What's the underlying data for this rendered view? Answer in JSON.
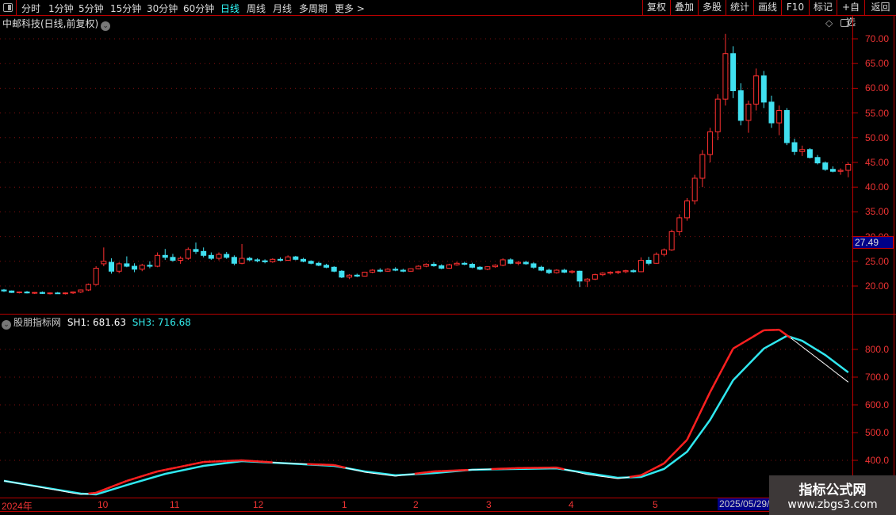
{
  "toolbar": {
    "periods": [
      "分时",
      "1分钟",
      "5分钟",
      "15分钟",
      "30分钟",
      "60分钟",
      "日线",
      "周线",
      "月线",
      "多周期",
      "更多 >"
    ],
    "selected": "日线",
    "buttons": [
      "复权",
      "叠加",
      "多股",
      "统计",
      "画线",
      "F10",
      "标记",
      "+自选",
      "返回"
    ]
  },
  "main": {
    "title": "中邮科技(日线,前复权)",
    "cursor_price": "27.49"
  },
  "indicator": {
    "name": "股朋指标网",
    "sh1_label": "SH1: 681.63",
    "sh3_label": "SH3: 716.68"
  },
  "time_axis": {
    "labels": [
      "2024年",
      "10",
      "11",
      "12",
      "1",
      "2",
      "3",
      "4",
      "5"
    ],
    "cursor_date": "2025/05/29/"
  },
  "watermark": {
    "line1": "指标公式网",
    "line2": "www.zbgs3.com"
  },
  "colors": {
    "up": "#ff3030",
    "down": "#40e0f0",
    "sh1": "#ffffff",
    "sh1_rising": "#ff2020",
    "sh3": "#30e8f0",
    "axis": "#bb0000"
  },
  "chart_data": [
    {
      "type": "candlestick",
      "title": "中邮科技(日线,前复权)",
      "ylim": [
        17,
        72
      ],
      "yticks": [
        "70.00",
        "65.00",
        "60.00",
        "55.00",
        "50.00",
        "45.00",
        "40.00",
        "35.00",
        "30.00",
        "25.00",
        "20.00"
      ],
      "ohlc": [
        [
          19.2,
          19.4,
          18.8,
          19.0
        ],
        [
          19.0,
          19.1,
          18.6,
          18.7
        ],
        [
          18.7,
          18.9,
          18.5,
          18.8
        ],
        [
          18.8,
          19.0,
          18.5,
          18.6
        ],
        [
          18.6,
          18.8,
          18.4,
          18.7
        ],
        [
          18.7,
          18.9,
          18.4,
          18.5
        ],
        [
          18.5,
          18.7,
          18.3,
          18.6
        ],
        [
          18.6,
          18.8,
          18.4,
          18.5
        ],
        [
          18.5,
          18.7,
          18.3,
          18.6
        ],
        [
          18.6,
          18.9,
          18.4,
          18.8
        ],
        [
          18.8,
          19.3,
          18.6,
          19.2
        ],
        [
          19.2,
          20.5,
          19.0,
          20.3
        ],
        [
          20.3,
          24.0,
          20.1,
          23.6
        ],
        [
          24.5,
          27.8,
          24.0,
          25.0
        ],
        [
          24.8,
          25.6,
          22.5,
          23.0
        ],
        [
          23.0,
          24.8,
          22.6,
          24.5
        ],
        [
          24.5,
          26.0,
          23.8,
          24.0
        ],
        [
          24.0,
          24.6,
          22.8,
          23.4
        ],
        [
          23.4,
          24.5,
          23.0,
          24.2
        ],
        [
          24.2,
          25.0,
          23.6,
          24.0
        ],
        [
          24.0,
          26.8,
          23.8,
          26.2
        ],
        [
          26.2,
          27.5,
          25.3,
          25.8
        ],
        [
          25.8,
          26.5,
          24.9,
          25.2
        ],
        [
          25.2,
          26.0,
          24.5,
          25.6
        ],
        [
          25.6,
          27.8,
          25.3,
          27.4
        ],
        [
          27.4,
          28.8,
          26.5,
          27.0
        ],
        [
          27.0,
          27.8,
          25.8,
          26.2
        ],
        [
          26.2,
          26.8,
          25.3,
          25.6
        ],
        [
          25.6,
          26.8,
          25.2,
          26.4
        ],
        [
          26.4,
          26.9,
          25.5,
          25.8
        ],
        [
          25.8,
          26.2,
          24.2,
          24.6
        ],
        [
          24.6,
          28.5,
          24.4,
          25.6
        ],
        [
          25.6,
          25.9,
          25.0,
          25.3
        ],
        [
          25.3,
          25.6,
          24.8,
          25.1
        ],
        [
          25.1,
          25.4,
          24.6,
          24.9
        ],
        [
          24.9,
          25.6,
          24.7,
          25.4
        ],
        [
          25.4,
          25.8,
          25.0,
          25.2
        ],
        [
          25.2,
          26.2,
          25.1,
          25.9
        ],
        [
          25.9,
          26.1,
          25.2,
          25.4
        ],
        [
          25.4,
          25.7,
          24.8,
          25.0
        ],
        [
          25.0,
          25.2,
          24.4,
          24.6
        ],
        [
          24.6,
          24.9,
          24.0,
          24.2
        ],
        [
          24.2,
          24.5,
          23.6,
          23.8
        ],
        [
          23.8,
          24.0,
          22.8,
          23.0
        ],
        [
          23.0,
          23.2,
          21.6,
          21.8
        ],
        [
          21.8,
          22.4,
          21.4,
          22.2
        ],
        [
          22.2,
          22.5,
          21.8,
          22.0
        ],
        [
          22.0,
          22.9,
          21.9,
          22.8
        ],
        [
          22.8,
          23.4,
          22.6,
          23.2
        ],
        [
          23.2,
          23.6,
          22.8,
          23.0
        ],
        [
          23.0,
          23.6,
          22.9,
          23.4
        ],
        [
          23.4,
          23.8,
          23.0,
          23.2
        ],
        [
          23.2,
          23.5,
          22.8,
          23.0
        ],
        [
          23.0,
          23.6,
          22.9,
          23.5
        ],
        [
          23.5,
          24.2,
          23.4,
          24.0
        ],
        [
          24.0,
          24.6,
          23.8,
          24.4
        ],
        [
          24.4,
          24.8,
          23.9,
          24.1
        ],
        [
          24.1,
          24.4,
          23.4,
          23.6
        ],
        [
          23.6,
          24.5,
          23.5,
          24.3
        ],
        [
          24.3,
          24.9,
          24.1,
          24.6
        ],
        [
          24.6,
          24.9,
          24.2,
          24.4
        ],
        [
          24.4,
          24.7,
          23.6,
          23.8
        ],
        [
          23.8,
          24.0,
          23.2,
          23.4
        ],
        [
          23.4,
          24.0,
          23.2,
          23.9
        ],
        [
          23.9,
          24.4,
          23.7,
          24.2
        ],
        [
          24.2,
          25.6,
          24.0,
          25.3
        ],
        [
          25.3,
          25.6,
          24.4,
          24.6
        ],
        [
          24.6,
          25.0,
          24.2,
          24.8
        ],
        [
          24.8,
          25.1,
          24.3,
          24.5
        ],
        [
          24.5,
          24.8,
          23.5,
          23.8
        ],
        [
          23.8,
          24.1,
          23.0,
          23.2
        ],
        [
          23.2,
          23.5,
          22.4,
          22.7
        ],
        [
          22.7,
          23.4,
          22.5,
          23.2
        ],
        [
          23.2,
          23.5,
          22.6,
          22.8
        ],
        [
          22.8,
          23.2,
          22.5,
          23.0
        ],
        [
          23.0,
          23.1,
          19.8,
          21.0
        ],
        [
          21.0,
          21.6,
          19.8,
          21.4
        ],
        [
          21.4,
          22.5,
          21.2,
          22.3
        ],
        [
          22.3,
          22.8,
          22.0,
          22.6
        ],
        [
          22.6,
          23.0,
          22.3,
          22.8
        ],
        [
          22.8,
          23.1,
          22.4,
          22.9
        ],
        [
          22.9,
          23.3,
          22.6,
          23.1
        ],
        [
          23.1,
          23.4,
          22.7,
          22.9
        ],
        [
          22.9,
          25.8,
          22.8,
          25.2
        ],
        [
          25.2,
          25.9,
          24.2,
          24.6
        ],
        [
          24.6,
          26.8,
          24.5,
          26.4
        ],
        [
          26.4,
          27.6,
          26.0,
          27.3
        ],
        [
          27.3,
          31.4,
          27.1,
          31.0
        ],
        [
          31.0,
          34.5,
          30.2,
          33.8
        ],
        [
          33.8,
          37.8,
          33.2,
          37.2
        ],
        [
          37.2,
          42.5,
          36.5,
          41.8
        ],
        [
          41.8,
          47.5,
          40.0,
          46.6
        ],
        [
          46.6,
          52.0,
          45.0,
          51.2
        ],
        [
          51.2,
          58.8,
          49.5,
          57.8
        ],
        [
          57.8,
          71.0,
          56.5,
          67.0
        ],
        [
          67.0,
          68.5,
          58.0,
          59.5
        ],
        [
          59.5,
          61.0,
          52.5,
          53.5
        ],
        [
          53.5,
          57.5,
          51.0,
          56.8
        ],
        [
          56.8,
          64.0,
          55.5,
          62.5
        ],
        [
          62.5,
          63.5,
          56.0,
          57.2
        ],
        [
          57.2,
          58.5,
          52.0,
          53.0
        ],
        [
          53.0,
          56.5,
          50.5,
          55.5
        ],
        [
          55.5,
          56.0,
          48.5,
          49.0
        ],
        [
          49.0,
          49.8,
          46.5,
          47.2
        ],
        [
          47.2,
          48.4,
          46.3,
          47.6
        ],
        [
          47.6,
          47.9,
          45.8,
          46.0
        ],
        [
          46.0,
          46.5,
          44.6,
          44.9
        ],
        [
          44.9,
          45.2,
          43.3,
          43.6
        ],
        [
          43.6,
          44.2,
          43.0,
          43.2
        ],
        [
          43.2,
          43.8,
          42.5,
          43.4
        ],
        [
          43.4,
          45.0,
          42.0,
          44.6
        ]
      ]
    },
    {
      "type": "line",
      "title": "股朋指标网",
      "ylim": [
        300,
        900
      ],
      "yticks": [
        "800.0",
        "700.0",
        "600.0",
        "500.0",
        "400.0"
      ],
      "series": [
        {
          "name": "SH1",
          "points": [
            [
              0,
              326
            ],
            [
              10,
              277
            ],
            [
              12,
              283
            ],
            [
              16,
              326
            ],
            [
              20,
              360
            ],
            [
              26,
              394
            ],
            [
              31,
              400
            ],
            [
              37,
              389
            ],
            [
              43,
              383
            ],
            [
              47,
              357
            ],
            [
              51,
              343
            ],
            [
              56,
              360
            ],
            [
              61,
              366
            ],
            [
              67,
              372
            ],
            [
              72,
              374
            ],
            [
              76,
              349
            ],
            [
              80,
              334
            ],
            [
              83,
              346
            ],
            [
              86,
              389
            ],
            [
              89,
              474
            ],
            [
              92,
              646
            ],
            [
              95,
              803
            ],
            [
              99,
              869
            ],
            [
              101,
              871
            ],
            [
              103,
              831
            ],
            [
              107,
              746
            ],
            [
              110,
              682
            ]
          ]
        },
        {
          "name": "SH3",
          "points": [
            [
              0,
              326
            ],
            [
              5,
              303
            ],
            [
              10,
              280
            ],
            [
              12,
              277
            ],
            [
              16,
              311
            ],
            [
              21,
              351
            ],
            [
              26,
              380
            ],
            [
              31,
              397
            ],
            [
              37,
              389
            ],
            [
              43,
              380
            ],
            [
              47,
              360
            ],
            [
              51,
              346
            ],
            [
              56,
              354
            ],
            [
              61,
              366
            ],
            [
              67,
              369
            ],
            [
              72,
              371
            ],
            [
              76,
              354
            ],
            [
              80,
              337
            ],
            [
              83,
              340
            ],
            [
              86,
              369
            ],
            [
              89,
              431
            ],
            [
              92,
              546
            ],
            [
              95,
              689
            ],
            [
              99,
              803
            ],
            [
              102,
              849
            ],
            [
              104,
              831
            ],
            [
              107,
              780
            ],
            [
              110,
              717
            ]
          ]
        }
      ]
    }
  ]
}
